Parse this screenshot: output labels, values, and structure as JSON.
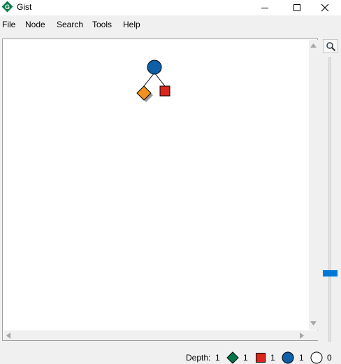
{
  "window": {
    "title": "Gist",
    "app_icon": "gist-logo-icon",
    "controls": [
      "minimize-icon",
      "maximize-icon",
      "close-icon"
    ]
  },
  "menu": {
    "items": [
      {
        "label": "File"
      },
      {
        "label": "Node"
      },
      {
        "label": "Search"
      },
      {
        "label": "Tools"
      },
      {
        "label": "Help"
      }
    ]
  },
  "tree": {
    "root": {
      "shape": "circle",
      "color": "#0e5fa6"
    },
    "children": [
      {
        "shape": "diamond",
        "color": "#f0901e"
      },
      {
        "shape": "square",
        "color": "#d8271d"
      }
    ]
  },
  "toolbar": {
    "zoom_icon": "magnifier-icon"
  },
  "status": {
    "depth_label": "Depth:",
    "depth_value": "1",
    "solutions_count": "1",
    "failures_count": "1",
    "choices_count": "1",
    "open_count": "0",
    "colors": {
      "solution": "#00794a",
      "failure": "#d8271d",
      "choice": "#0e5fa6",
      "open": "#ffffff"
    }
  }
}
